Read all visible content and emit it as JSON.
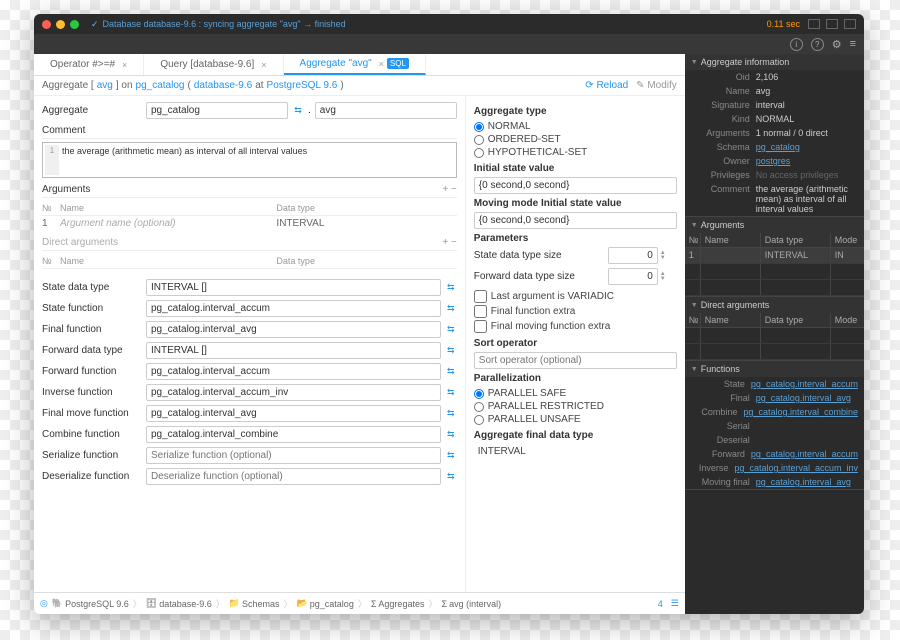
{
  "titlebar": {
    "text": "Database database-9.6 : syncing aggregate \"avg\" → finished",
    "time": "0.11 sec"
  },
  "tabs": [
    {
      "label": "Operator #>=#"
    },
    {
      "label": "Query [database-9.6]"
    },
    {
      "label": "Aggregate \"avg\"",
      "active": true
    }
  ],
  "breadcrumb": {
    "prefix": "Aggregate [",
    "link1": "avg",
    "mid": "] on",
    "link2": "pg_catalog",
    "paren1": "(",
    "link3": "database-9.6",
    "at": "at",
    "link4": "PostgreSQL 9.6",
    "paren2": ")",
    "reload": "Reload",
    "modify": "Modify"
  },
  "form": {
    "aggregate_label": "Aggregate",
    "aggregate_schema": "pg_catalog",
    "aggregate_name": "avg",
    "comment_label": "Comment",
    "comment_value": "the average (arithmetic mean) as interval of all interval values",
    "arguments_label": "Arguments",
    "args_head": {
      "num": "№",
      "name": "Name",
      "type": "Data type"
    },
    "args_row": {
      "num": "1",
      "name_ph": "Argument name (optional)",
      "type": "INTERVAL"
    },
    "direct_args_label": "Direct arguments",
    "fields": [
      {
        "label": "State data type",
        "value": "INTERVAL []"
      },
      {
        "label": "State function",
        "value": "pg_catalog.interval_accum"
      },
      {
        "label": "Final function",
        "value": "pg_catalog.interval_avg"
      },
      {
        "label": "Forward data type",
        "value": "INTERVAL []"
      },
      {
        "label": "Forward function",
        "value": "pg_catalog.interval_accum"
      },
      {
        "label": "Inverse function",
        "value": "pg_catalog.interval_accum_inv"
      },
      {
        "label": "Final move function",
        "value": "pg_catalog.interval_avg"
      },
      {
        "label": "Combine function",
        "value": "pg_catalog.interval_combine"
      },
      {
        "label": "Serialize function",
        "placeholder": "Serialize function (optional)"
      },
      {
        "label": "Deserialize function",
        "placeholder": "Deserialize function (optional)"
      }
    ]
  },
  "right_form": {
    "type_head": "Aggregate type",
    "type_opts": [
      "NORMAL",
      "ORDERED-SET",
      "HYPOTHETICAL-SET"
    ],
    "initial_head": "Initial state value",
    "initial_val": "{0 second,0 second}",
    "moving_head": "Moving mode Initial state value",
    "moving_val": "{0 second,0 second}",
    "params_head": "Parameters",
    "state_size_label": "State data type size",
    "state_size_val": "0",
    "fwd_size_label": "Forward data type size",
    "fwd_size_val": "0",
    "chk1": "Last argument is VARIADIC",
    "chk2": "Final function extra",
    "chk3": "Final moving function extra",
    "sort_head": "Sort operator",
    "sort_ph": "Sort operator (optional)",
    "para_head": "Parallelization",
    "para_opts": [
      "PARALLEL SAFE",
      "PARALLEL RESTRICTED",
      "PARALLEL UNSAFE"
    ],
    "final_type_head": "Aggregate final data type",
    "final_type_val": "INTERVAL"
  },
  "bottom": {
    "db": "PostgreSQL 9.6",
    "database": "database-9.6",
    "schemas": "Schemas",
    "catalog": "pg_catalog",
    "aggregates": "Aggregates",
    "item": "avg (interval)",
    "count": "4"
  },
  "sidebar": {
    "info_head": "Aggregate information",
    "info": [
      {
        "k": "Oid",
        "v": "2,106"
      },
      {
        "k": "Name",
        "v": "avg"
      },
      {
        "k": "Signature",
        "v": "interval"
      },
      {
        "k": "Kind",
        "v": "NORMAL"
      },
      {
        "k": "Arguments",
        "v": "1 normal / 0 direct"
      },
      {
        "k": "Schema",
        "v": "pg_catalog",
        "link": true
      },
      {
        "k": "Owner",
        "v": "postgres",
        "link": true
      },
      {
        "k": "Privileges",
        "v": "No access privileges",
        "dim": true
      },
      {
        "k": "Comment",
        "v": "the average (arithmetic mean) as interval of all interval values"
      }
    ],
    "args_head": "Arguments",
    "args_cols": {
      "num": "№",
      "name": "Name",
      "type": "Data type",
      "mode": "Mode"
    },
    "args_row": {
      "num": "1",
      "name": "",
      "type": "INTERVAL",
      "mode": "IN"
    },
    "direct_head": "Direct arguments",
    "func_head": "Functions",
    "funcs": [
      {
        "k": "State",
        "v": "pg_catalog.interval_accum"
      },
      {
        "k": "Final",
        "v": "pg_catalog.interval_avg"
      },
      {
        "k": "Combine",
        "v": "pg_catalog.interval_combine"
      },
      {
        "k": "Serial",
        "v": ""
      },
      {
        "k": "Deserial",
        "v": ""
      },
      {
        "k": "Forward",
        "v": "pg_catalog.interval_accum"
      },
      {
        "k": "Inverse",
        "v": "pg_catalog.interval_accum_inv"
      },
      {
        "k": "Moving final",
        "v": "pg_catalog.interval_avg"
      }
    ]
  }
}
